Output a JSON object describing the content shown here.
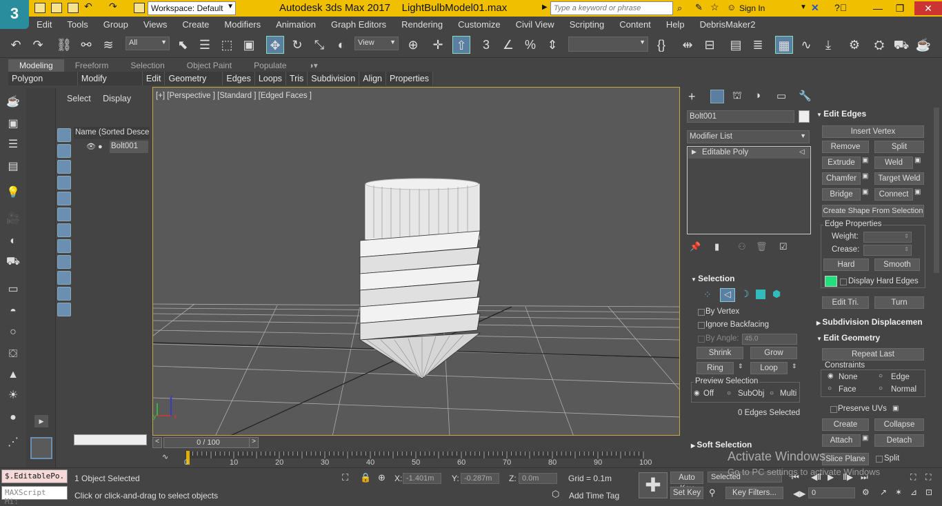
{
  "title": {
    "app_icon": "3",
    "workspace": "Workspace: Default",
    "window_title": "Autodesk 3ds Max 2017",
    "file_name": "LightBulbModel01.max",
    "search_placeholder": "Type a keyword or phrase",
    "sign_in": "Sign In"
  },
  "menu": [
    "Edit",
    "Tools",
    "Group",
    "Views",
    "Create",
    "Modifiers",
    "Animation",
    "Graph Editors",
    "Rendering",
    "Customize",
    "Civil View",
    "Scripting",
    "Content",
    "Help",
    "DebrisMaker2"
  ],
  "toolbar": {
    "filter": "All",
    "ref_coord": "View"
  },
  "ribbon": {
    "tabs": [
      "Modeling",
      "Freeform",
      "Selection",
      "Object Paint",
      "Populate"
    ],
    "items": [
      "Polygon Modeling",
      "Modify Selection",
      "Edit",
      "Geometry (All)",
      "Edges",
      "Loops",
      "Tris",
      "Subdivision",
      "Align",
      "Properties"
    ]
  },
  "scene": {
    "tab_select": "Select",
    "tab_display": "Display",
    "column_header": "Name (Sorted Descen",
    "object": "Bolt001"
  },
  "viewport": {
    "label": "[+] [Perspective ] [Standard ] [Edged Faces ]"
  },
  "timeline": {
    "frame": "0 / 100",
    "ticks": [
      "0",
      "10",
      "20",
      "30",
      "40",
      "50",
      "60",
      "70",
      "80",
      "90",
      "100"
    ]
  },
  "command": {
    "object_name": "Bolt001",
    "modifier_list": "Modifier List",
    "stack_item": "Editable Poly",
    "selection_title": "Selection",
    "by_vertex": "By Vertex",
    "ignore_backfacing": "Ignore Backfacing",
    "by_angle": "By Angle:",
    "angle_value": "45.0",
    "shrink": "Shrink",
    "grow": "Grow",
    "ring": "Ring",
    "loop": "Loop",
    "preview_title": "Preview Selection",
    "off": "Off",
    "subobj": "SubObj",
    "multi": "Multi",
    "edges_selected": "0 Edges Selected",
    "soft_selection": "Soft Selection"
  },
  "edit_edges": {
    "title": "Edit Edges",
    "insert_vertex": "Insert Vertex",
    "remove": "Remove",
    "split": "Split",
    "extrude": "Extrude",
    "weld": "Weld",
    "chamfer": "Chamfer",
    "target_weld": "Target Weld",
    "bridge": "Bridge",
    "connect": "Connect",
    "create_shape": "Create Shape From Selection",
    "edge_properties": "Edge Properties",
    "weight": "Weight:",
    "crease": "Crease:",
    "hard": "Hard",
    "smooth": "Smooth",
    "display_hard": "Display Hard Edges",
    "edit_tri": "Edit Tri.",
    "turn": "Turn",
    "subdivision_disp": "Subdivision Displacemen",
    "edit_geometry": "Edit Geometry",
    "repeat_last": "Repeat Last",
    "constraints": "Constraints",
    "none": "None",
    "edge": "Edge",
    "face": "Face",
    "normal": "Normal",
    "preserve_uvs": "Preserve UVs",
    "create": "Create",
    "collapse": "Collapse",
    "attach": "Attach",
    "detach": "Detach",
    "slice_plane": "Slice Plane",
    "split2": "Split",
    "hard_color": "#1fe07a"
  },
  "status": {
    "maxscript_result": "$.EditablePo.",
    "maxscript_listener": "MAXScript Mi:",
    "objects_selected": "1 Object Selected",
    "prompt": "Click or click-and-drag to select objects",
    "x_label": "X:",
    "x_value": "-1.401m",
    "y_label": "Y:",
    "y_value": "-0.287m",
    "z_label": "Z:",
    "z_value": "0.0m",
    "grid": "Grid = 0.1m",
    "add_time_tag": "Add Time Tag",
    "auto_key": "Auto Key",
    "selected": "Selected",
    "set_key": "Set Key",
    "key_filters": "Key Filters...",
    "frame_value": "0"
  },
  "watermark": {
    "line1": "Activate Windows",
    "line2": "Go to PC settings to activate Windows"
  }
}
